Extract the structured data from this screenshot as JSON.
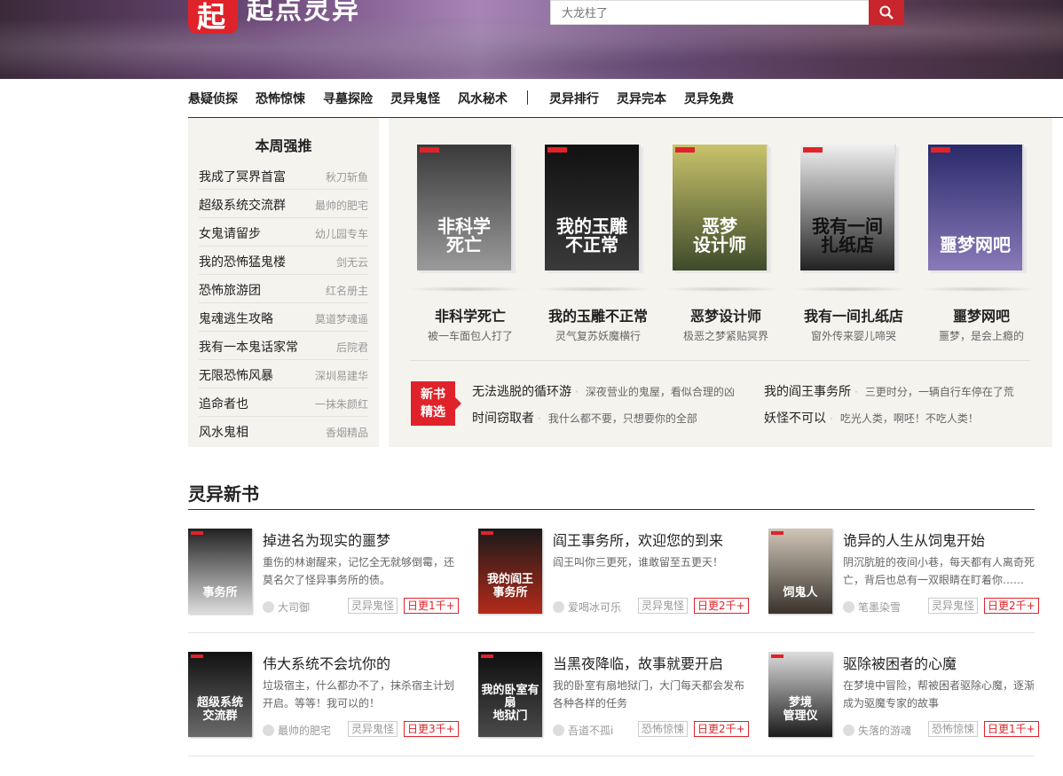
{
  "header": {
    "logo_char": "起",
    "logo_text": "起点灵异",
    "search_placeholder": "大龙柱了"
  },
  "nav": {
    "items": [
      "悬疑侦探",
      "恐怖惊悚",
      "寻墓探险",
      "灵异鬼怪",
      "风水秘术"
    ],
    "extra": [
      "灵异排行",
      "灵异完本",
      "灵异免费"
    ]
  },
  "weekly": {
    "title": "本周强推",
    "items": [
      {
        "title": "我成了冥界首富",
        "author": "秋刀斩鱼"
      },
      {
        "title": "超级系统交流群",
        "author": "最帅的肥宅"
      },
      {
        "title": "女鬼请留步",
        "author": "幼儿园专车"
      },
      {
        "title": "我的恐怖猛鬼楼",
        "author": "剑无云"
      },
      {
        "title": "恐怖旅游团",
        "author": "红名册主"
      },
      {
        "title": "鬼魂逃生攻略",
        "author": "莫道梦魂遥"
      },
      {
        "title": "我有一本鬼话家常",
        "author": "后院君"
      },
      {
        "title": "无限恐怖风暴",
        "author": "深圳易建华"
      },
      {
        "title": "追命者也",
        "author": "一抹朱颜红"
      },
      {
        "title": "风水鬼相",
        "author": "香烟精品"
      }
    ]
  },
  "featured": {
    "books": [
      {
        "name": "非科学死亡",
        "desc": "被一车面包人打了",
        "cover_text": "非科学\n死亡",
        "colors": [
          "#3a3a3a",
          "#9a9a9a"
        ]
      },
      {
        "name": "我的玉雕不正常",
        "desc": "灵气复苏妖魔横行",
        "cover_text": "我的玉雕\n不正常",
        "colors": [
          "#111111",
          "#3a3a3a"
        ]
      },
      {
        "name": "恶梦设计师",
        "desc": "极恶之梦紧贴冥界",
        "cover_text": "恶梦\n设计师",
        "colors": [
          "#c8c36a",
          "#3e4a2a"
        ]
      },
      {
        "name": "我有一间扎纸店",
        "desc": "窗外传来婴儿啼哭",
        "cover_text": "我有一间\n扎纸店",
        "colors": [
          "#f0f0f0",
          "#222222"
        ]
      },
      {
        "name": "噩梦网吧",
        "desc": "噩梦，是会上瘾的",
        "cover_text": "噩梦网吧",
        "colors": [
          "#2a2a6a",
          "#8a7ab8"
        ]
      }
    ],
    "badge": [
      "新书",
      "精选"
    ],
    "picks": [
      {
        "title": "无法逃脱的循环游",
        "desc": "深夜营业的鬼屋，看似合理的凶"
      },
      {
        "title": "我的阎王事务所",
        "desc": "三更时分，一辆自行车停在了荒"
      },
      {
        "title": "时间窃取者",
        "desc": "我什么都不要，只想要你的全部"
      },
      {
        "title": "妖怪不可以",
        "desc": "吃光人类，啊呸！不吃人类！"
      }
    ]
  },
  "new_books": {
    "title": "灵异新书",
    "items": [
      {
        "title": "掉进名为现实的噩梦",
        "desc": "重伤的林谢醒来，记忆全无就够倒霉，还莫名欠了怪异事务所的债。",
        "author": "大司御",
        "genre": "灵异鬼怪",
        "update": "日更1千+",
        "cover_text": "事务所",
        "colors": [
          "#222222",
          "#dddddd"
        ]
      },
      {
        "title": "阎王事务所，欢迎您的到来",
        "desc": "阎王叫你三更死，谁敢留至五更天！",
        "author": "爱喝冰可乐",
        "genre": "灵异鬼怪",
        "update": "日更2千+",
        "cover_text": "我的阎王\n事务所",
        "colors": [
          "#1a1a1a",
          "#b32a1a"
        ]
      },
      {
        "title": "诡异的人生从饲鬼开始",
        "desc": "阴沉肮脏的夜间小巷，每天都有人离奇死亡，背后也总有一双眼睛在盯着你……",
        "author": "笔墨染雪",
        "genre": "灵异鬼怪",
        "update": "日更2千+",
        "cover_text": "饲鬼人",
        "colors": [
          "#cfc6b8",
          "#3a332c"
        ]
      },
      {
        "title": "伟大系统不会坑你的",
        "desc": "垃圾宿主，什么都办不了，抹杀宿主计划开启。等等！我可以的！",
        "author": "最帅的肥宅",
        "genre": "灵异鬼怪",
        "update": "日更3千+",
        "cover_text": "超级系统\n交流群",
        "colors": [
          "#111111",
          "#6a6a6a"
        ]
      },
      {
        "title": "当黑夜降临，故事就要开启",
        "desc": "我的卧室有扇地狱门，大门每天都会发布各种各样的任务",
        "author": "吾道不孤i",
        "genre": "恐怖惊悚",
        "update": "日更2千+",
        "cover_text": "我的卧室有扇\n地狱门",
        "colors": [
          "#0e0e0e",
          "#4a4a4a"
        ]
      },
      {
        "title": "驱除被困者的心魔",
        "desc": "在梦境中冒险，帮被困者驱除心魔，逐渐成为驱魔专家的故事",
        "author": "失落的游魂",
        "genre": "恐怖惊悚",
        "update": "日更1千+",
        "cover_text": "梦境\n管理仪",
        "colors": [
          "#dddddd",
          "#1a1a1a"
        ]
      }
    ]
  }
}
